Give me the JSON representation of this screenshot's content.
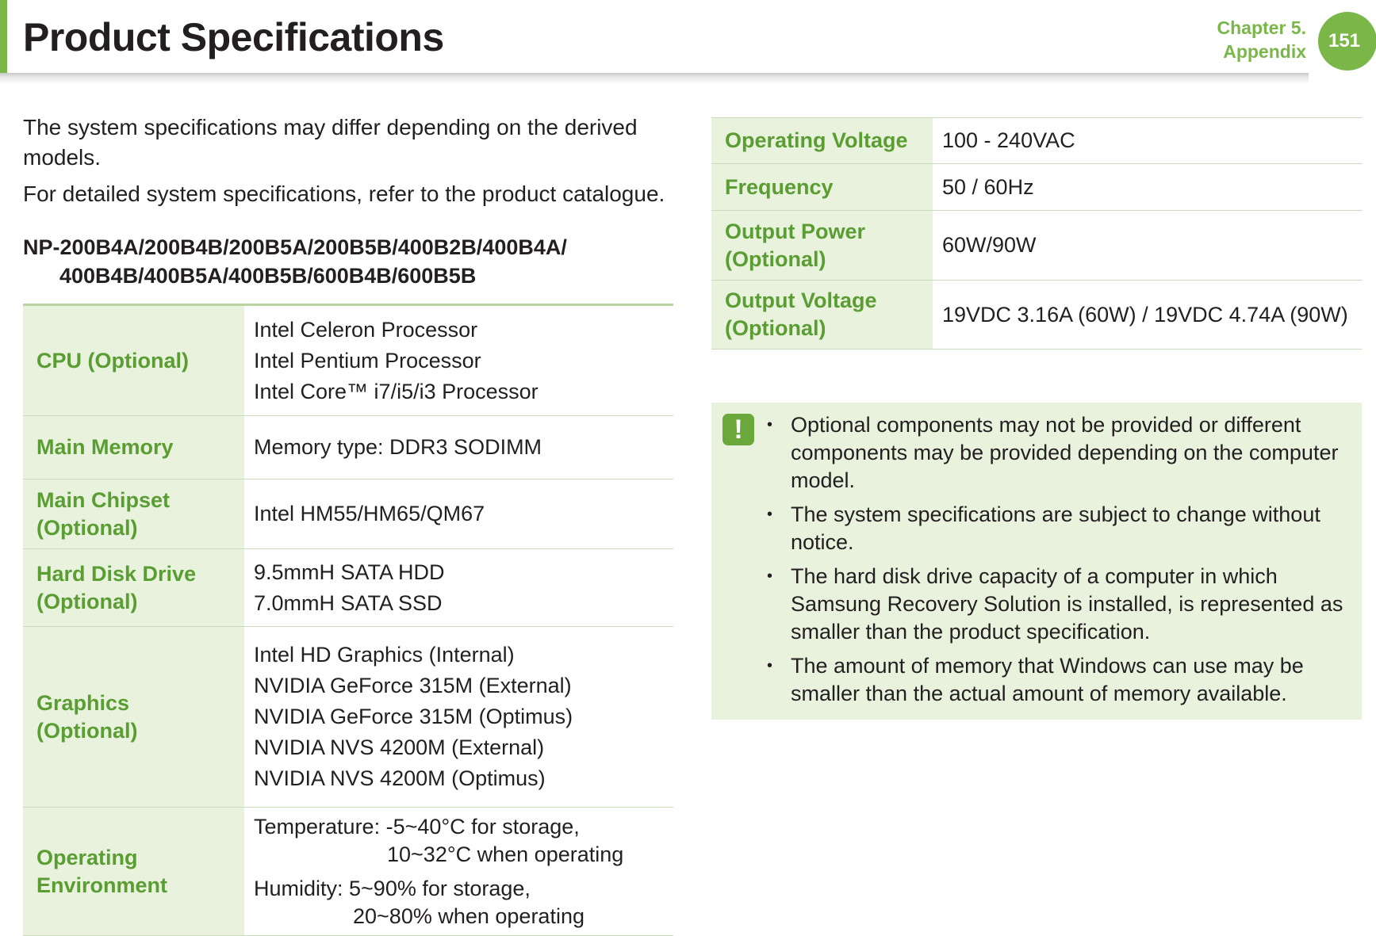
{
  "header": {
    "title": "Product Specifications",
    "chapter_line1": "Chapter 5.",
    "chapter_line2": "Appendix",
    "page_number": "151",
    "accent_color": "#7ab648"
  },
  "intro": {
    "paragraph1": "The system specifications may differ depending on the derived models.",
    "paragraph2": "For detailed system specifications, refer to the product catalogue."
  },
  "model": {
    "line1": "NP-200B4A/200B4B/200B5A/200B5B/400B2B/400B4A/",
    "line2": "400B4B/400B5A/400B5B/600B4B/600B5B"
  },
  "left_table": {
    "rows": [
      {
        "label": "CPU (Optional)",
        "values": [
          "Intel Celeron Processor",
          "Intel Pentium Processor",
          "Intel Core™ i7/i5/i3 Processor"
        ]
      },
      {
        "label": "Main Memory",
        "values": [
          "Memory type: DDR3 SODIMM"
        ]
      },
      {
        "label": "Main Chipset (Optional)",
        "values": [
          "Intel HM55/HM65/QM67"
        ]
      },
      {
        "label": "Hard Disk Drive (Optional)",
        "values": [
          "9.5mmH SATA HDD",
          "7.0mmH SATA SSD"
        ]
      },
      {
        "label": "Graphics (Optional)",
        "values": [
          "Intel HD Graphics (Internal)",
          "NVIDIA GeForce 315M (External)",
          "NVIDIA GeForce 315M (Optimus)",
          "NVIDIA NVS 4200M (External)",
          "NVIDIA NVS 4200M (Optimus)"
        ]
      },
      {
        "label": "Operating Environment",
        "values": [
          "Temperature: -5~40°C for storage,",
          "10~32°C when operating",
          "Humidity: 5~90% for storage,",
          "20~80% when operating"
        ]
      }
    ]
  },
  "right_table": {
    "rows": [
      {
        "label": "Operating Voltage",
        "values": [
          "100 - 240VAC"
        ]
      },
      {
        "label": "Frequency",
        "values": [
          "50 / 60Hz"
        ]
      },
      {
        "label": "Output Power (Optional)",
        "values": [
          "60W/90W"
        ]
      },
      {
        "label": "Output Voltage (Optional)",
        "values": [
          "19VDC 3.16A (60W) / 19VDC 4.74A (90W)"
        ]
      }
    ]
  },
  "note": {
    "icon": "exclamation-icon",
    "icon_glyph": "!",
    "items": [
      "Optional components may not be provided or different components may be provided depending on the computer model.",
      "The system specifications are subject to change without notice.",
      "The hard disk drive capacity of a computer in which Samsung Recovery Solution is installed, is represented as smaller than the product specification.",
      "The amount of memory that Windows can use may be smaller than the actual amount of memory available."
    ]
  }
}
